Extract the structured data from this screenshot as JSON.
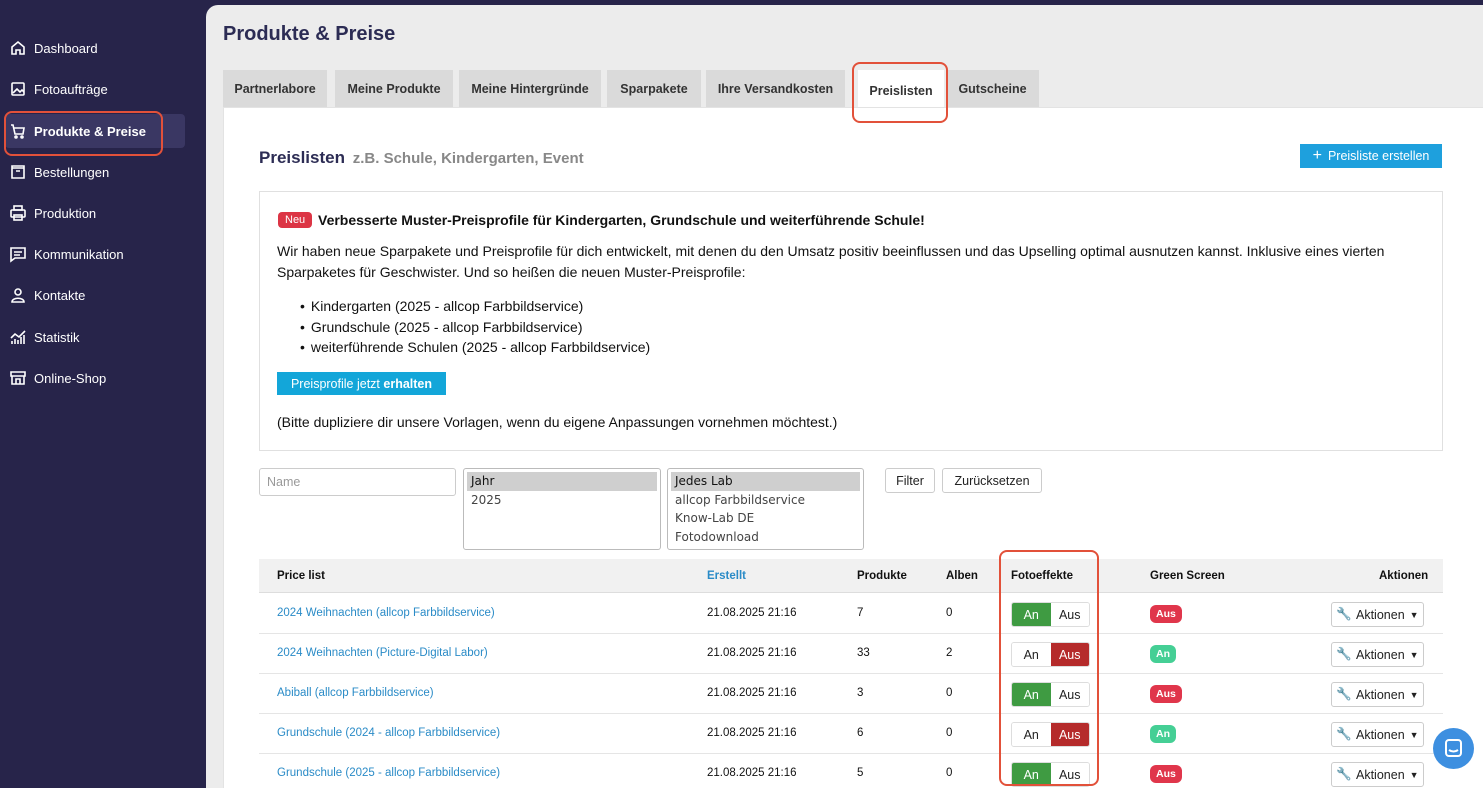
{
  "sidebar": {
    "items": [
      {
        "label": "Dashboard",
        "icon": "home-icon"
      },
      {
        "label": "Fotoaufträge",
        "icon": "image-icon"
      },
      {
        "label": "Produkte & Preise",
        "icon": "cart-icon",
        "active": true
      },
      {
        "label": "Bestellungen",
        "icon": "inbox-icon"
      },
      {
        "label": "Produktion",
        "icon": "printer-icon"
      },
      {
        "label": "Kommunikation",
        "icon": "message-icon"
      },
      {
        "label": "Kontakte",
        "icon": "user-icon"
      },
      {
        "label": "Statistik",
        "icon": "chart-icon"
      },
      {
        "label": "Online-Shop",
        "icon": "store-icon"
      }
    ]
  },
  "page": {
    "title": "Produkte & Preise"
  },
  "tabs": [
    {
      "label": "Partnerlabore"
    },
    {
      "label": "Meine Produkte"
    },
    {
      "label": "Meine Hintergründe"
    },
    {
      "label": "Sparpakete"
    },
    {
      "label": "Ihre Versandkosten"
    },
    {
      "label": "Preislisten",
      "active": true
    },
    {
      "label": "Gutscheine"
    }
  ],
  "panel": {
    "title": "Preislisten",
    "subtitle": "z.B. Schule, Kindergarten, Event",
    "create_button": "Preisliste erstellen"
  },
  "info": {
    "badge": "Neu",
    "headline": "Verbesserte Muster-Preisprofile für Kindergarten, Grundschule und weiterführende Schule!",
    "text": "Wir haben neue Sparpakete und Preisprofile für dich entwickelt, mit denen du den Umsatz positiv beeinflussen und das Upselling optimal ausnutzen kannst. Inklusive eines vierten Sparpaketes für Geschwister. Und so heißen die neuen Muster-Preisprofile:",
    "list": [
      "Kindergarten (2025 - allcop Farbbildservice)",
      "Grundschule (2025 - allcop Farbbildservice)",
      "weiterführende Schulen (2025 - allcop Farbbildservice)"
    ],
    "button_a": "Preisprofile jetzt",
    "button_b": "erhalten",
    "note": "(Bitte dupliziere dir unsere Vorlagen, wenn du eigene Anpassungen vornehmen möchtest.)"
  },
  "filters": {
    "name_placeholder": "Name",
    "year_options": [
      "Jahr",
      "2025"
    ],
    "lab_options": [
      "Jedes Lab",
      "allcop Farbbildservice",
      "Know-Lab DE",
      "Fotodownload"
    ],
    "filter_button": "Filter",
    "reset_button": "Zurücksetzen"
  },
  "table": {
    "headers": {
      "name": "Price list",
      "created": "Erstellt",
      "products": "Produkte",
      "albums": "Alben",
      "effects": "Fotoeffekte",
      "greenscreen": "Green Screen",
      "actions": "Aktionen"
    },
    "on_label": "An",
    "off_label": "Aus",
    "actions_label": "Aktionen",
    "rows": [
      {
        "name": "2024 Weihnachten (allcop Farbbildservice)",
        "created": "21.08.2025 21:16",
        "products": "7",
        "albums": "0",
        "effects_on": true,
        "greenscreen": "Aus",
        "gs_color": "#e0364b"
      },
      {
        "name": "2024 Weihnachten (Picture-Digital Labor)",
        "created": "21.08.2025 21:16",
        "products": "33",
        "albums": "2",
        "effects_on": false,
        "greenscreen": "An",
        "gs_color": "#45cf95"
      },
      {
        "name": "Abiball (allcop Farbbildservice)",
        "created": "21.08.2025 21:16",
        "products": "3",
        "albums": "0",
        "effects_on": true,
        "greenscreen": "Aus",
        "gs_color": "#e0364b"
      },
      {
        "name": "Grundschule (2024 - allcop Farbbildservice)",
        "created": "21.08.2025 21:16",
        "products": "6",
        "albums": "0",
        "effects_on": false,
        "greenscreen": "An",
        "gs_color": "#45cf95"
      },
      {
        "name": "Grundschule (2025 - allcop Farbbildservice)",
        "created": "21.08.2025 21:16",
        "products": "5",
        "albums": "0",
        "effects_on": true,
        "greenscreen": "Aus",
        "gs_color": "#e0364b"
      }
    ]
  },
  "colors": {
    "sidebar": "#27244a",
    "accent": "#1ea0dd",
    "highlight": "#e2513a",
    "on_green": "#3f9b42",
    "off_red": "#b52b2b"
  }
}
